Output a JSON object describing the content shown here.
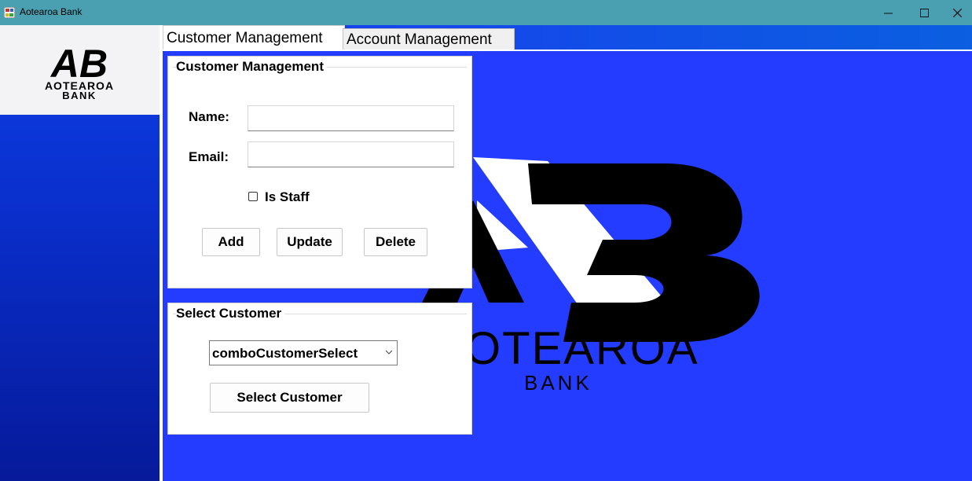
{
  "window": {
    "title": "Aotearoa Bank",
    "minimize_symbol": "—",
    "maximize_symbol": "☐",
    "close_symbol": "✕"
  },
  "logo": {
    "monogram": "AB",
    "line1": "AOTEAROA",
    "line2": "BANK"
  },
  "tabs": [
    {
      "label": "Customer Management",
      "active": true
    },
    {
      "label": "Account Management",
      "active": false
    }
  ],
  "customer_management": {
    "legend": "Customer Management",
    "name_label": "Name:",
    "name_value": "",
    "email_label": "Email:",
    "email_value": "",
    "is_staff_label": "Is Staff",
    "is_staff_checked": false,
    "add_label": "Add",
    "update_label": "Update",
    "delete_label": "Delete"
  },
  "select_customer": {
    "legend": "Select Customer",
    "combo_value": "comboCustomerSelect",
    "button_label": "Select Customer"
  },
  "background_logo": {
    "monogram": "AB",
    "line1": "OTEAROA",
    "line2": "BANK"
  },
  "colors": {
    "titlebar": "#4a9fb0",
    "content_bg": "#233cff",
    "sidebar_top": "#0d3fe6",
    "sidebar_bottom": "#061a9a"
  }
}
